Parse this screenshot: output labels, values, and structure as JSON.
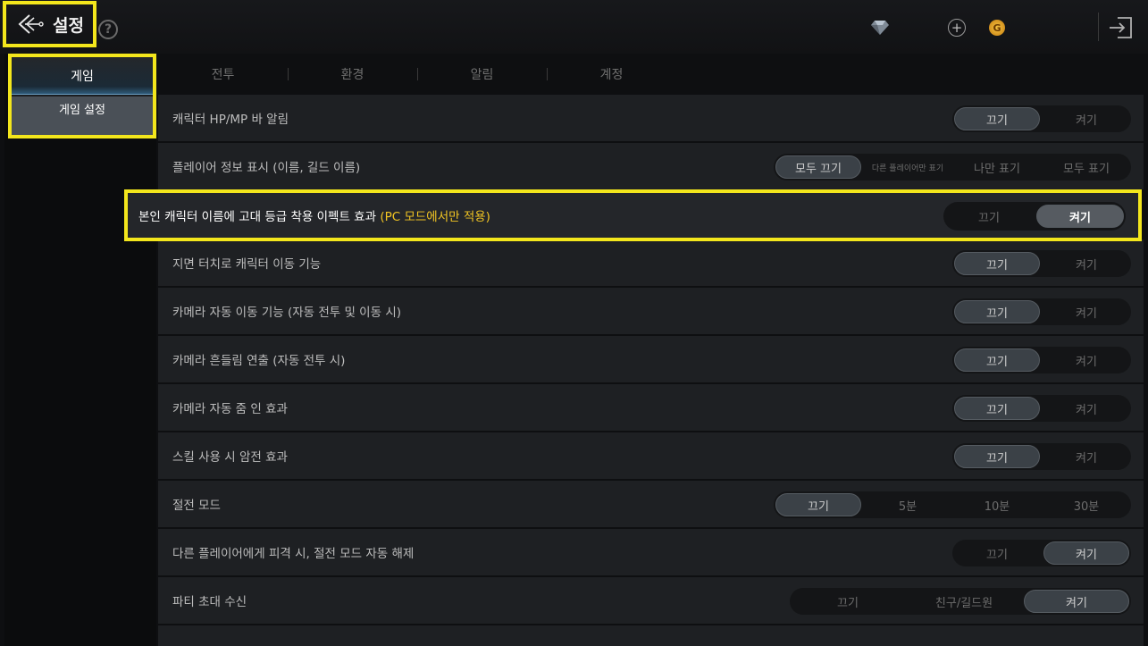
{
  "header": {
    "title": "설정",
    "help_glyph": "?",
    "gold_glyph": "G"
  },
  "sidebar": {
    "category": "게임",
    "item": "게임 설정"
  },
  "tabs": [
    "전투",
    "환경",
    "알림",
    "계정"
  ],
  "settings": [
    {
      "label": "캐릭터 HP/MP 바 알림",
      "options": [
        "끄기",
        "켜기"
      ],
      "selected": 0
    },
    {
      "label": "플레이어 정보 표시 (이름, 길드 이름)",
      "options": [
        "모두 끄기",
        "다른 플레이어만 표기",
        "나만 표기",
        "모두 표기"
      ],
      "selected": 0
    },
    {
      "label": "본인 캐릭터 이름에 고대 등급 착용 이펙트 효과 ",
      "label_note": "(PC 모드에서만 적용)",
      "options": [
        "끄기",
        "켜기"
      ],
      "selected": 1
    },
    {
      "label": "지면 터치로 캐릭터 이동 기능",
      "options": [
        "끄기",
        "켜기"
      ],
      "selected": 0
    },
    {
      "label": "카메라 자동 이동 기능 (자동 전투 및 이동 시)",
      "options": [
        "끄기",
        "켜기"
      ],
      "selected": 0
    },
    {
      "label": "카메라 흔들림 연출 (자동 전투 시)",
      "options": [
        "끄기",
        "켜기"
      ],
      "selected": 0
    },
    {
      "label": "카메라 자동 줌 인 효과",
      "options": [
        "끄기",
        "켜기"
      ],
      "selected": 0
    },
    {
      "label": "스킬 사용 시 암전 효과",
      "options": [
        "끄기",
        "켜기"
      ],
      "selected": 0
    },
    {
      "label": "절전 모드",
      "options": [
        "끄기",
        "5분",
        "10분",
        "30분"
      ],
      "selected": 0
    },
    {
      "label": "다른 플레이어에게 피격 시, 절전 모드 자동 해제",
      "options": [
        "끄기",
        "켜기"
      ],
      "selected": 1
    },
    {
      "label": "파티 초대 수신",
      "options": [
        "끄기",
        "친구/길드원",
        "켜기"
      ],
      "selected": 2
    }
  ],
  "icons": {
    "back": "back-arrow-icon",
    "help": "help-icon",
    "gem": "diamond-icon",
    "plus": "plus-icon",
    "gold": "gold-coin-icon",
    "exit": "exit-icon"
  },
  "colors": {
    "highlight": "#f3e61c",
    "note": "#f3c623"
  }
}
